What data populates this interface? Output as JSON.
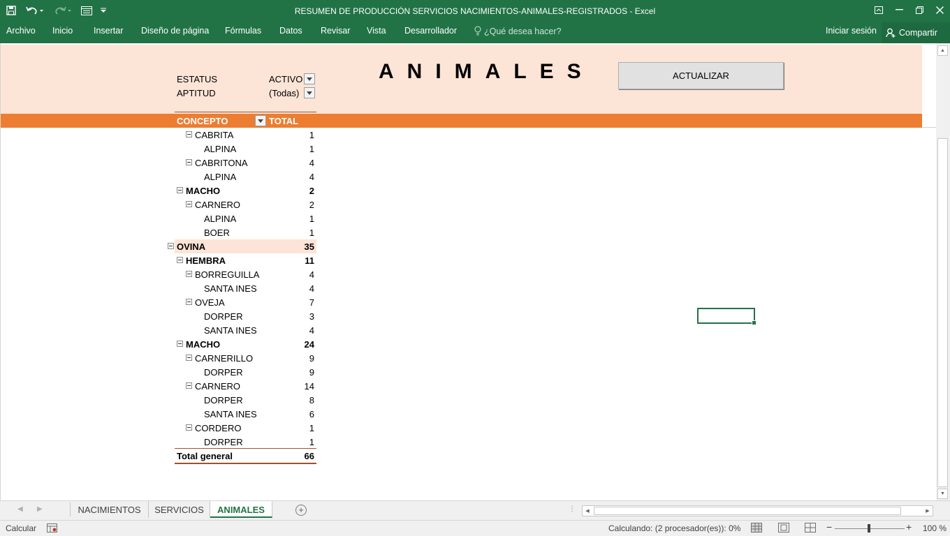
{
  "window": {
    "title": "RESUMEN DE PRODUCCIÓN SERVICIOS NACIMIENTOS-ANIMALES-REGISTRADOS - Excel",
    "icons": [
      "save-icon",
      "undo-icon",
      "redo-icon",
      "form-icon",
      "customize-icon",
      "ribbon-display-icon",
      "minimize-icon",
      "restore-icon",
      "close-icon"
    ]
  },
  "ribbon": {
    "tabs": [
      "Archivo",
      "Inicio",
      "Insertar",
      "Diseño de página",
      "Fórmulas",
      "Datos",
      "Revisar",
      "Vista",
      "Desarrollador"
    ],
    "tell_me": "¿Qué desea hacer?",
    "sign_in": "Iniciar sesión",
    "share": "Compartir"
  },
  "sheet": {
    "title": "ANIMALES",
    "button": "ACTUALIZAR",
    "filters": [
      {
        "label": "ESTATUS",
        "value": "ACTIVO"
      },
      {
        "label": "APTITUD",
        "value": "(Todas)"
      }
    ],
    "pivot": {
      "header": {
        "concept": "CONCEPTO",
        "total": "TOTAL"
      },
      "rows": [
        {
          "label": "CABRITA",
          "value": "1",
          "level": 2,
          "bold": false,
          "collapse": true
        },
        {
          "label": "ALPINA",
          "value": "1",
          "level": 3,
          "bold": false,
          "collapse": false
        },
        {
          "label": "CABRITONA",
          "value": "4",
          "level": 2,
          "bold": false,
          "collapse": true
        },
        {
          "label": "ALPINA",
          "value": "4",
          "level": 3,
          "bold": false,
          "collapse": false
        },
        {
          "label": "MACHO",
          "value": "2",
          "level": 1,
          "bold": true,
          "collapse": true
        },
        {
          "label": "CARNERO",
          "value": "2",
          "level": 2,
          "bold": false,
          "collapse": true
        },
        {
          "label": "ALPINA",
          "value": "1",
          "level": 3,
          "bold": false,
          "collapse": false
        },
        {
          "label": "BOER",
          "value": "1",
          "level": 3,
          "bold": false,
          "collapse": false
        },
        {
          "label": "OVINA",
          "value": "35",
          "level": 0,
          "bold": true,
          "collapse": true,
          "highlight": true
        },
        {
          "label": "HEMBRA",
          "value": "11",
          "level": 1,
          "bold": true,
          "collapse": true
        },
        {
          "label": "BORREGUILLA",
          "value": "4",
          "level": 2,
          "bold": false,
          "collapse": true
        },
        {
          "label": "SANTA INES",
          "value": "4",
          "level": 3,
          "bold": false,
          "collapse": false
        },
        {
          "label": "OVEJA",
          "value": "7",
          "level": 2,
          "bold": false,
          "collapse": true
        },
        {
          "label": "DORPER",
          "value": "3",
          "level": 3,
          "bold": false,
          "collapse": false
        },
        {
          "label": "SANTA INES",
          "value": "4",
          "level": 3,
          "bold": false,
          "collapse": false
        },
        {
          "label": "MACHO",
          "value": "24",
          "level": 1,
          "bold": true,
          "collapse": true
        },
        {
          "label": "CARNERILLO",
          "value": "9",
          "level": 2,
          "bold": false,
          "collapse": true
        },
        {
          "label": "DORPER",
          "value": "9",
          "level": 3,
          "bold": false,
          "collapse": false
        },
        {
          "label": "CARNERO",
          "value": "14",
          "level": 2,
          "bold": false,
          "collapse": true
        },
        {
          "label": "DORPER",
          "value": "8",
          "level": 3,
          "bold": false,
          "collapse": false
        },
        {
          "label": "SANTA INES",
          "value": "6",
          "level": 3,
          "bold": false,
          "collapse": false
        },
        {
          "label": "CORDERO",
          "value": "1",
          "level": 2,
          "bold": false,
          "collapse": true
        },
        {
          "label": "DORPER",
          "value": "1",
          "level": 3,
          "bold": false,
          "collapse": false
        }
      ],
      "grand_total": {
        "label": "Total general",
        "value": "66"
      }
    }
  },
  "sheet_tabs": [
    "NACIMIENTOS",
    "SERVICIOS",
    "ANIMALES"
  ],
  "active_sheet": "ANIMALES",
  "status": {
    "mode": "Calcular",
    "calc": "Calculando: (2 procesador(es)): 0%",
    "zoom": "100 %"
  },
  "colors": {
    "excel_green": "#217346",
    "orange": "#ed7d31",
    "light_orange": "#fce4d6"
  }
}
